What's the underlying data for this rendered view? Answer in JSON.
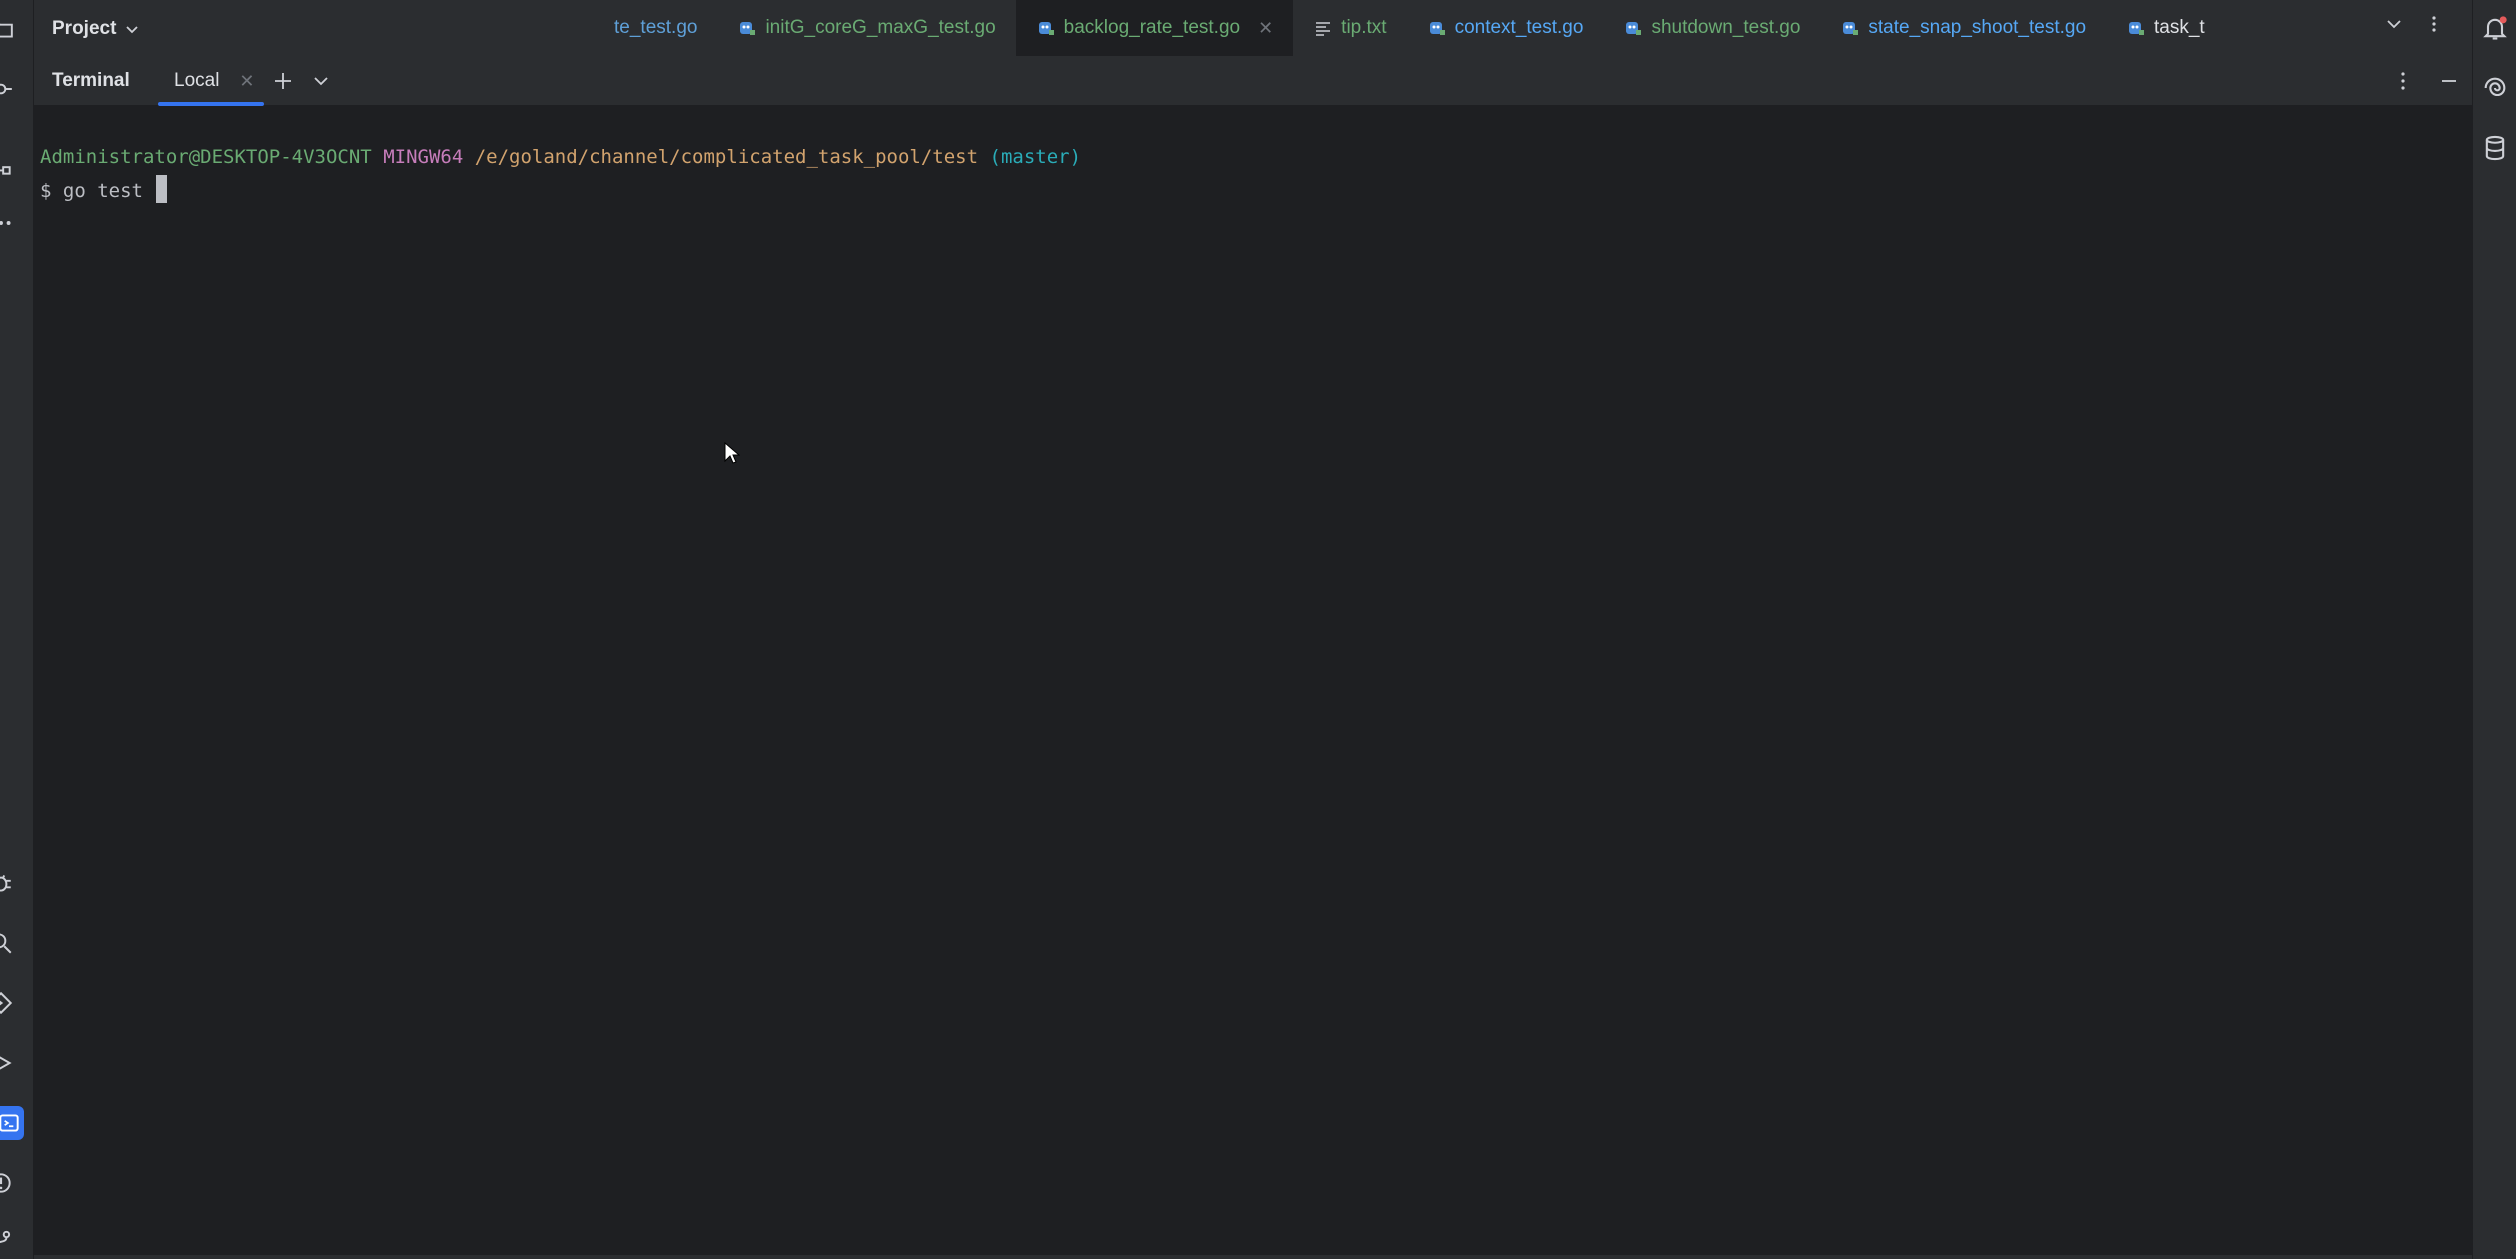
{
  "project": {
    "label": "Project"
  },
  "editor_tabs": [
    {
      "label": "te_test.go",
      "style": "blue-muted",
      "icon": "go-file-icon"
    },
    {
      "label": "initG_coreG_maxG_test.go",
      "style": "green",
      "icon": "go-test-file-icon"
    },
    {
      "label": "backlog_rate_test.go",
      "style": "active",
      "icon": "go-test-file-icon",
      "closable": true
    },
    {
      "label": "tip.txt",
      "style": "green",
      "icon": "text-file-icon"
    },
    {
      "label": "context_test.go",
      "style": "blue",
      "icon": "go-test-file-icon"
    },
    {
      "label": "shutdown_test.go",
      "style": "green",
      "icon": "go-test-file-icon"
    },
    {
      "label": "state_snap_shoot_test.go",
      "style": "blue",
      "icon": "go-test-file-icon"
    },
    {
      "label": "task_t",
      "style": "white",
      "icon": "go-test-file-icon"
    }
  ],
  "terminal": {
    "title": "Terminal",
    "tab_label": "Local",
    "prompt": {
      "user_host": "Administrator@DESKTOP-4V3OCNT",
      "shell": "MINGW64",
      "path": "/e/goland/channel/complicated_task_pool/test",
      "branch": "(master)",
      "symbol": "$",
      "command": "go test "
    }
  },
  "colors": {
    "accent": "#3574f0",
    "prompt_user": "#6aab73",
    "prompt_shell": "#c77dbb",
    "prompt_path": "#d2a36e",
    "prompt_branch": "#2aacb8",
    "background": "#1e1f22",
    "panel": "#2b2d30"
  }
}
